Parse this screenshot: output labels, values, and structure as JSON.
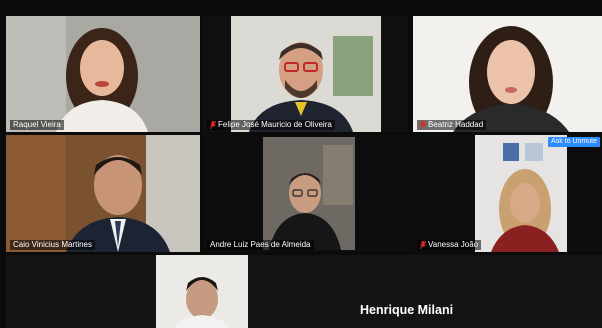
{
  "participants": [
    {
      "name": "Raquel Vieira",
      "muted": false,
      "bg": "#a8a7a2"
    },
    {
      "name": "Felipe José Mauricio de Oliveira",
      "muted": true,
      "bg": "#d7d5cf"
    },
    {
      "name": "Beatriz Haddad",
      "muted": true,
      "bg": "#f4f2ee"
    },
    {
      "name": "Caio Vinicius Martines",
      "muted": false,
      "bg": "#7a5230"
    },
    {
      "name": "Andre Luiz Paes de Almeida",
      "muted": false,
      "bg": "#5a5650"
    },
    {
      "name": "Vanessa João",
      "muted": true,
      "bg": "#e6e4e2"
    },
    {
      "name": "Henrique Milani",
      "muted": false,
      "bg": "#eceae6"
    }
  ],
  "ask_to_unmute": "Ask to Unmute",
  "speaker_label": "Henrique Milani",
  "colors": {
    "active_border": "#d7e86b",
    "mute_icon": "#e02828",
    "unmute_button": "#2d8cff"
  }
}
